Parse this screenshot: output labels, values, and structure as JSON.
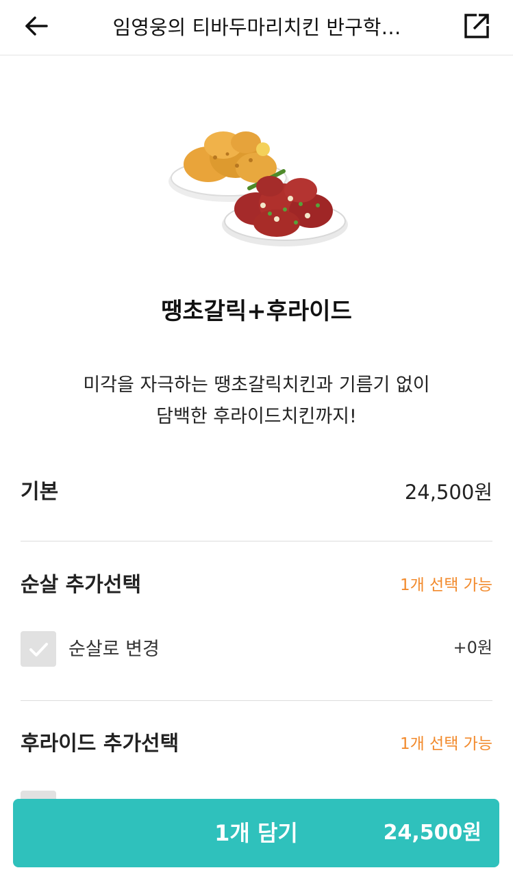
{
  "header": {
    "title": "임영웅의 티바두마리치킨 반구학…"
  },
  "product": {
    "name": "땡초갈릭+후라이드",
    "description_line1": "미각을 자극하는 땡초갈릭치킨과 기름기 없이",
    "description_line2": "담백한 후라이드치킨까지!"
  },
  "base": {
    "label": "기본",
    "price": "24,500원"
  },
  "sections": [
    {
      "title": "순살 추가선택",
      "limit": "1개 선택 가능",
      "options": [
        {
          "label": "순살로 변경",
          "price": "+0원"
        }
      ]
    },
    {
      "title": "후라이드 추가선택",
      "limit": "1개 선택 가능"
    }
  ],
  "cta": {
    "label": "1개 담기",
    "price": "24,500원",
    "color": "#2fc1bc"
  },
  "colors": {
    "accent_orange": "#f28a2c"
  },
  "icons": {
    "back": "arrow-left-icon",
    "share": "external-link-icon",
    "check": "check-icon"
  }
}
